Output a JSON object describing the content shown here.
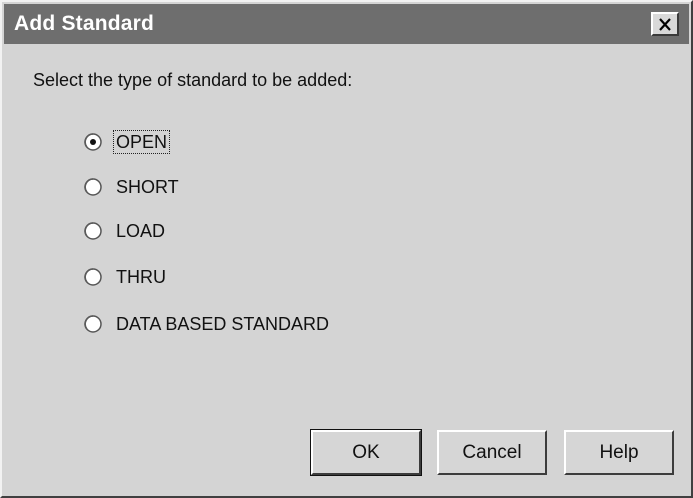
{
  "window": {
    "title": "Add Standard",
    "close_glyph": "✕"
  },
  "prompt": "Select the type of standard to be added:",
  "options": [
    {
      "label": "OPEN",
      "selected": true
    },
    {
      "label": "SHORT",
      "selected": false
    },
    {
      "label": "LOAD",
      "selected": false
    },
    {
      "label": "THRU",
      "selected": false
    },
    {
      "label": "DATA BASED STANDARD",
      "selected": false
    }
  ],
  "buttons": {
    "ok": "OK",
    "cancel": "Cancel",
    "help": "Help"
  },
  "icons": {
    "close": "close-icon",
    "radio": "radio-icon"
  }
}
